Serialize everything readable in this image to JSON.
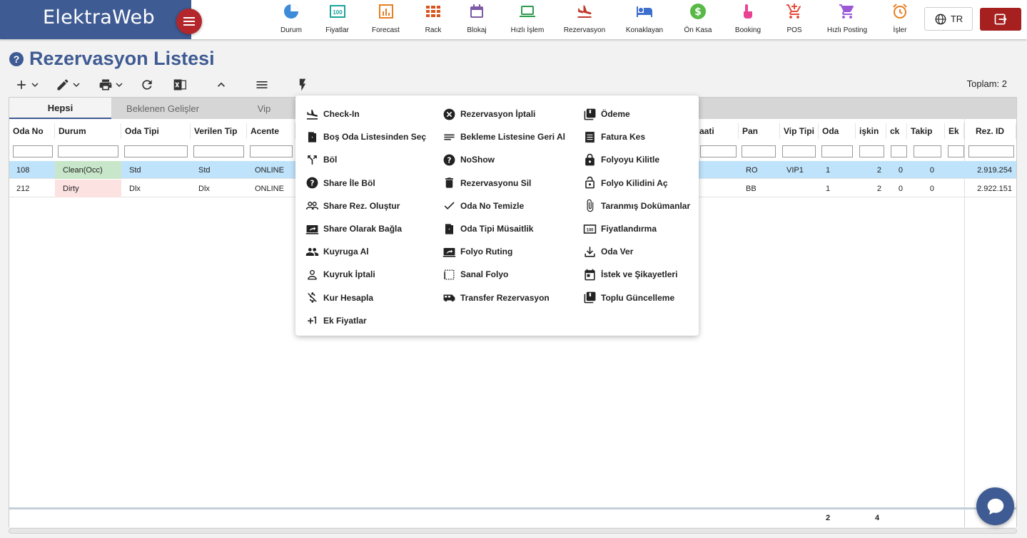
{
  "app": {
    "brand": "ElektraWeb"
  },
  "nav": [
    {
      "label": "Durum",
      "icon": "pie-chart-icon",
      "color": "#3d8bd9"
    },
    {
      "label": "Fiyatlar",
      "icon": "price-tag-icon",
      "color": "#1aa39a"
    },
    {
      "label": "Forecast",
      "icon": "bar-chart-icon",
      "color": "#e67e22"
    },
    {
      "label": "Rack",
      "icon": "grid-icon",
      "color": "#d9531e"
    },
    {
      "label": "Blokaj",
      "icon": "calendar-icon",
      "color": "#7d5ba6"
    },
    {
      "label": "Hızlı İşlem",
      "icon": "laptop-icon",
      "color": "#2e9b4f"
    },
    {
      "label": "Rezervasyon",
      "icon": "plane-landing-icon",
      "color": "#c0392b"
    },
    {
      "label": "Konaklayan",
      "icon": "bed-icon",
      "color": "#3d6fcf"
    },
    {
      "label": "Ön Kasa",
      "icon": "dollar-icon",
      "color": "#58b947"
    },
    {
      "label": "Booking",
      "icon": "touch-icon",
      "color": "#e84393"
    },
    {
      "label": "POS",
      "icon": "cart-plus-icon",
      "color": "#e74c3c"
    },
    {
      "label": "Hızlı Posting",
      "icon": "cart-icon",
      "color": "#9b59d6"
    },
    {
      "label": "İşler",
      "icon": "alarm-icon",
      "color": "#e67e22"
    }
  ],
  "header": {
    "lang": "TR"
  },
  "page": {
    "title": "Rezervasyon Listesi",
    "total": "Toplam: 2"
  },
  "tabs": [
    "Hepsi",
    "Beklenen Gelişler",
    "Vip"
  ],
  "columns": [
    "Oda No",
    "Durum",
    "Oda Tipi",
    "Verilen Tip",
    "Acente",
    "aati",
    "Pan",
    "Vip Tipi",
    "Oda",
    "işkin",
    "ck",
    "Takip",
    "Ek",
    "Rez. ID"
  ],
  "rows": [
    {
      "oda_no": "108",
      "durum": "Clean(Occ)",
      "oda_tipi": "Std",
      "verilen_tip": "Std",
      "acente": "ONLINE",
      "pan": "RO",
      "vip_tipi": "VIP1",
      "oda": "1",
      "yetiskin": "2",
      "cocuk": "0",
      "takip": "0",
      "rez_id": "2.919.254"
    },
    {
      "oda_no": "212",
      "durum": "Dirty",
      "oda_tipi": "Dlx",
      "verilen_tip": "Dlx",
      "acente": "ONLINE",
      "pan": "BB",
      "vip_tipi": "",
      "oda": "1",
      "yetiskin": "2",
      "cocuk": "0",
      "takip": "0",
      "rez_id": "2.922.151"
    }
  ],
  "footer": {
    "oda_total": "2",
    "yetiskin_total": "4"
  },
  "menu": {
    "col1": [
      "Check-In",
      "Boş Oda Listesinden Seç",
      "Böl",
      "Share İle Böl",
      "Share Rez. Oluştur",
      "Share Olarak Bağla",
      "Kuyruga Al",
      "Kuyruk İptali",
      "Kur Hesapla",
      "Ek Fiyatlar"
    ],
    "col2": [
      "Rezervasyon İptali",
      "Bekleme Listesine Geri Al",
      "NoShow",
      "Rezervasyonu Sil",
      "Oda No Temizle",
      "Oda Tipi Müsaitlik",
      "Folyo Ruting",
      "Sanal Folyo",
      "Transfer Rezervasyon"
    ],
    "col3": [
      "Ödeme",
      "Fatura Kes",
      "Folyoyu Kilitle",
      "Folyo Kilidini Aç",
      "Taranmış Dokümanlar",
      "Fiyatlandırma",
      "Oda Ver",
      "İstek ve Şikayetleri",
      "Toplu Güncelleme"
    ]
  },
  "colors": {
    "brand": "#3f5b93",
    "accent": "#b3262b",
    "clean": "#c8e6c9",
    "dirty": "#fde2e2",
    "selected_row": "#bfe3fb"
  }
}
